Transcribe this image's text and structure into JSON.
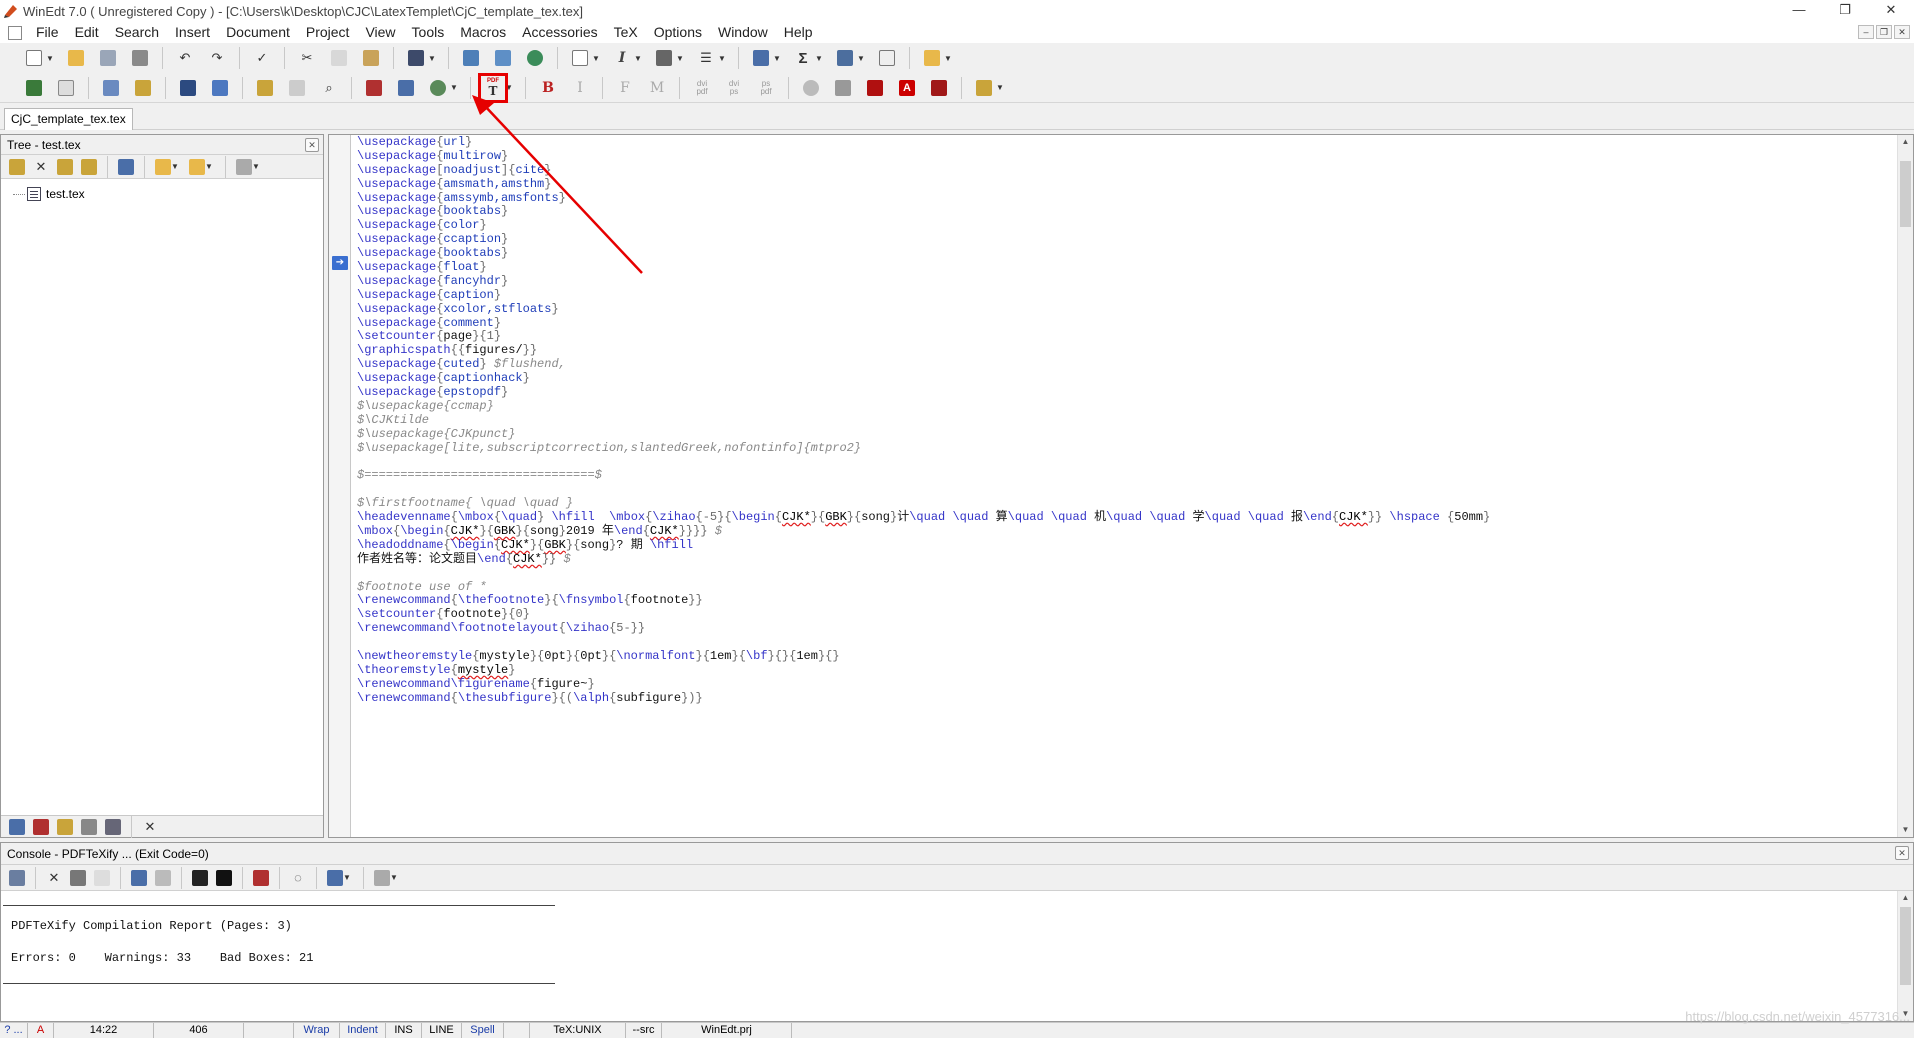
{
  "window": {
    "title": "WinEdt 7.0  ( Unregistered  Copy )  - [C:\\Users\\k\\Desktop\\CJC\\LatexTemplet\\CjC_template_tex.tex]",
    "controls": [
      "—",
      "❐",
      "✕"
    ]
  },
  "menu": [
    "File",
    "Edit",
    "Search",
    "Insert",
    "Document",
    "Project",
    "View",
    "Tools",
    "Macros",
    "Accessories",
    "TeX",
    "Options",
    "Window",
    "Help"
  ],
  "mdi_controls": [
    "–",
    "❐",
    "✕"
  ],
  "toolbar2_text": {
    "pdf_icon_label": "PDF",
    "bold": "B",
    "italic": "I",
    "f": "F",
    "m": "M",
    "dvi_pdf_top": "dvi",
    "dvi_pdf_bottom": "pdf",
    "dvi_ps_top": "dvi",
    "dvi_ps_bottom": "ps",
    "ps_pdf_top": "ps",
    "ps_pdf_bottom": "pdf"
  },
  "doc_tab": "CjC_template_tex.tex",
  "tree": {
    "title": "Tree - test.tex",
    "node": "test.tex"
  },
  "editor_lines": [
    [
      [
        "kw",
        "\\usepackage"
      ],
      [
        "br",
        "{"
      ],
      [
        "arg",
        "url"
      ],
      [
        "br",
        "}"
      ]
    ],
    [
      [
        "kw",
        "\\usepackage"
      ],
      [
        "br",
        "{"
      ],
      [
        "arg",
        "multirow"
      ],
      [
        "br",
        "}"
      ]
    ],
    [
      [
        "kw",
        "\\usepackage"
      ],
      [
        "br",
        "["
      ],
      [
        "arg",
        "noadjust"
      ],
      [
        "br",
        "]{"
      ],
      [
        "arg",
        "cite"
      ],
      [
        "br",
        "}"
      ]
    ],
    [
      [
        "kw",
        "\\usepackage"
      ],
      [
        "br",
        "{"
      ],
      [
        "arg",
        "amsmath,amsthm"
      ],
      [
        "br",
        "}"
      ]
    ],
    [
      [
        "kw",
        "\\usepackage"
      ],
      [
        "br",
        "{"
      ],
      [
        "arg",
        "amssymb,amsfonts"
      ],
      [
        "br",
        "}"
      ]
    ],
    [
      [
        "kw",
        "\\usepackage"
      ],
      [
        "br",
        "{"
      ],
      [
        "arg",
        "booktabs"
      ],
      [
        "br",
        "}"
      ]
    ],
    [
      [
        "kw",
        "\\usepackage"
      ],
      [
        "br",
        "{"
      ],
      [
        "arg",
        "color"
      ],
      [
        "br",
        "}"
      ]
    ],
    [
      [
        "kw",
        "\\usepackage"
      ],
      [
        "br",
        "{"
      ],
      [
        "arg",
        "ccaption"
      ],
      [
        "br",
        "}"
      ]
    ],
    [
      [
        "kw",
        "\\usepackage"
      ],
      [
        "br",
        "{"
      ],
      [
        "arg",
        "booktabs"
      ],
      [
        "br",
        "}"
      ]
    ],
    [
      [
        "kw",
        "\\usepackage"
      ],
      [
        "br",
        "{"
      ],
      [
        "arg",
        "float"
      ],
      [
        "br",
        "}"
      ]
    ],
    [
      [
        "kw",
        "\\usepackage"
      ],
      [
        "br",
        "{"
      ],
      [
        "arg",
        "fancyhdr"
      ],
      [
        "br",
        "}"
      ]
    ],
    [
      [
        "kw",
        "\\usepackage"
      ],
      [
        "br",
        "{"
      ],
      [
        "arg",
        "caption"
      ],
      [
        "br",
        "}"
      ]
    ],
    [
      [
        "kw",
        "\\usepackage"
      ],
      [
        "br",
        "{"
      ],
      [
        "arg",
        "xcolor,stfloats"
      ],
      [
        "br",
        "}"
      ]
    ],
    [
      [
        "kw",
        "\\usepackage"
      ],
      [
        "br",
        "{"
      ],
      [
        "arg",
        "comment"
      ],
      [
        "br",
        "}"
      ]
    ],
    [
      [
        "kw",
        "\\setcounter"
      ],
      [
        "br",
        "{"
      ],
      [
        "tx",
        "page"
      ],
      [
        "br",
        "}{"
      ],
      [
        "br",
        "1"
      ],
      [
        "br",
        "}"
      ]
    ],
    [
      [
        "kw",
        "\\graphicspath"
      ],
      [
        "br",
        "{{"
      ],
      [
        "tx",
        "figures/"
      ],
      [
        "br",
        "}}"
      ]
    ],
    [
      [
        "kw",
        "\\usepackage"
      ],
      [
        "br",
        "{"
      ],
      [
        "arg",
        "cuted"
      ],
      [
        "br",
        "}"
      ],
      [
        "cm",
        " $flushend,"
      ]
    ],
    [
      [
        "kw",
        "\\usepackage"
      ],
      [
        "br",
        "{"
      ],
      [
        "arg",
        "captionhack"
      ],
      [
        "br",
        "}"
      ]
    ],
    [
      [
        "kw",
        "\\usepackage"
      ],
      [
        "br",
        "{"
      ],
      [
        "arg",
        "epstopdf"
      ],
      [
        "br",
        "}"
      ]
    ],
    [
      [
        "cm",
        "$\\usepackage{ccmap}"
      ]
    ],
    [
      [
        "cm",
        "$\\CJKtilde"
      ]
    ],
    [
      [
        "cm",
        "$\\usepackage{CJKpunct}"
      ]
    ],
    [
      [
        "cm",
        "$\\usepackage[lite,subscriptcorrection,slantedGreek,nofontinfo]{mtpro2}"
      ]
    ],
    [],
    [
      [
        "cm",
        "$================================$"
      ]
    ],
    [],
    [
      [
        "cm",
        "$\\firstfootname{ \\quad \\quad }"
      ]
    ],
    [
      [
        "kw",
        "\\headevenname"
      ],
      [
        "br",
        "{"
      ],
      [
        "kw",
        "\\mbox"
      ],
      [
        "br",
        "{"
      ],
      [
        "kw",
        "\\quad"
      ],
      [
        "br",
        "} "
      ],
      [
        "kw",
        "\\hfill"
      ],
      [
        "tx",
        "  "
      ],
      [
        "kw",
        "\\mbox"
      ],
      [
        "br",
        "{"
      ],
      [
        "kw",
        "\\zihao"
      ],
      [
        "br",
        "{-5}{"
      ],
      [
        "kw",
        "\\begin"
      ],
      [
        "br",
        "{"
      ],
      [
        "sq",
        "CJK*"
      ],
      [
        "br",
        "}{"
      ],
      [
        "sq",
        "GBK"
      ],
      [
        "br",
        "}{"
      ],
      [
        "tx",
        "song"
      ],
      [
        "br",
        "}"
      ],
      [
        "tx",
        "计"
      ],
      [
        "kw",
        "\\quad"
      ],
      [
        "tx",
        " "
      ],
      [
        "kw",
        "\\quad"
      ],
      [
        "tx",
        " 算"
      ],
      [
        "kw",
        "\\quad"
      ],
      [
        "tx",
        " "
      ],
      [
        "kw",
        "\\quad"
      ],
      [
        "tx",
        " 机"
      ],
      [
        "kw",
        "\\quad"
      ],
      [
        "tx",
        " "
      ],
      [
        "kw",
        "\\quad"
      ],
      [
        "tx",
        " 学"
      ],
      [
        "kw",
        "\\quad"
      ],
      [
        "tx",
        " "
      ],
      [
        "kw",
        "\\quad"
      ],
      [
        "tx",
        " 报"
      ],
      [
        "kw",
        "\\end"
      ],
      [
        "br",
        "{"
      ],
      [
        "sq",
        "CJK*"
      ],
      [
        "br",
        "}} "
      ],
      [
        "kw",
        "\\hspace"
      ],
      [
        "br",
        " {"
      ],
      [
        "tx",
        "50mm"
      ],
      [
        "br",
        "}"
      ]
    ],
    [
      [
        "kw",
        "\\mbox"
      ],
      [
        "br",
        "{"
      ],
      [
        "kw",
        "\\begin"
      ],
      [
        "br",
        "{"
      ],
      [
        "sq",
        "CJK*"
      ],
      [
        "br",
        "}{"
      ],
      [
        "sq",
        "GBK"
      ],
      [
        "br",
        "}{"
      ],
      [
        "tx",
        "song"
      ],
      [
        "br",
        "}"
      ],
      [
        "tx",
        "2019 年"
      ],
      [
        "kw",
        "\\end"
      ],
      [
        "br",
        "{"
      ],
      [
        "sq",
        "CJK*"
      ],
      [
        "br",
        "}}}}"
      ],
      [
        "cm",
        " $"
      ]
    ],
    [
      [
        "kw",
        "\\headoddname"
      ],
      [
        "br",
        "{"
      ],
      [
        "kw",
        "\\begin"
      ],
      [
        "br",
        "{"
      ],
      [
        "sq",
        "CJK*"
      ],
      [
        "br",
        "}{"
      ],
      [
        "sq",
        "GBK"
      ],
      [
        "br",
        "}{"
      ],
      [
        "tx",
        "song"
      ],
      [
        "br",
        "}"
      ],
      [
        "tx",
        "? 期 "
      ],
      [
        "kw",
        "\\hfill"
      ]
    ],
    [
      [
        "tx",
        "作者姓名等：论文题目"
      ],
      [
        "kw",
        "\\end"
      ],
      [
        "br",
        "{"
      ],
      [
        "sq",
        "CJK*"
      ],
      [
        "br",
        "}}"
      ],
      [
        "cm",
        " $"
      ]
    ],
    [],
    [
      [
        "cm",
        "$footnote use of *"
      ]
    ],
    [
      [
        "kw",
        "\\renewcommand"
      ],
      [
        "br",
        "{"
      ],
      [
        "kw",
        "\\thefootnote"
      ],
      [
        "br",
        "}{"
      ],
      [
        "kw",
        "\\fnsymbol"
      ],
      [
        "br",
        "{"
      ],
      [
        "tx",
        "footnote"
      ],
      [
        "br",
        "}}"
      ]
    ],
    [
      [
        "kw",
        "\\setcounter"
      ],
      [
        "br",
        "{"
      ],
      [
        "tx",
        "footnote"
      ],
      [
        "br",
        "}{"
      ],
      [
        "br",
        "0"
      ],
      [
        "br",
        "}"
      ]
    ],
    [
      [
        "kw",
        "\\renewcommand"
      ],
      [
        "kw",
        "\\footnotelayout"
      ],
      [
        "br",
        "{"
      ],
      [
        "kw",
        "\\zihao"
      ],
      [
        "br",
        "{5-}}"
      ]
    ],
    [],
    [
      [
        "kw",
        "\\newtheoremstyle"
      ],
      [
        "br",
        "{"
      ],
      [
        "tx",
        "mystyle"
      ],
      [
        "br",
        "}{"
      ],
      [
        "tx",
        "0pt"
      ],
      [
        "br",
        "}{"
      ],
      [
        "tx",
        "0pt"
      ],
      [
        "br",
        "}{"
      ],
      [
        "kw",
        "\\normalfont"
      ],
      [
        "br",
        "}{"
      ],
      [
        "tx",
        "1em"
      ],
      [
        "br",
        "}{"
      ],
      [
        "kw",
        "\\bf"
      ],
      [
        "br",
        "}{}{"
      ],
      [
        "tx",
        "1em"
      ],
      [
        "br",
        "}{}"
      ]
    ],
    [
      [
        "kw",
        "\\theoremstyle"
      ],
      [
        "br",
        "{"
      ],
      [
        "sq",
        "mystyle"
      ],
      [
        "br",
        "}"
      ]
    ],
    [
      [
        "kw",
        "\\renewcommand"
      ],
      [
        "kw",
        "\\figurename"
      ],
      [
        "br",
        "{"
      ],
      [
        "tx",
        "figure~"
      ],
      [
        "br",
        "}"
      ]
    ],
    [
      [
        "kw",
        "\\renewcommand"
      ],
      [
        "br",
        "{"
      ],
      [
        "kw",
        "\\thesubfigure"
      ],
      [
        "br",
        "}{("
      ],
      [
        "kw",
        "\\alph"
      ],
      [
        "br",
        "{"
      ],
      [
        "tx",
        "subfigure"
      ],
      [
        "br",
        "})}"
      ]
    ]
  ],
  "console": {
    "title": "Console - PDFTeXify ... (Exit Code=0)",
    "report": "PDFTeXify Compilation Report (Pages: 3)",
    "summary": "Errors: 0    Warnings: 33    Bad Boxes: 21"
  },
  "status": {
    "help": "? ...",
    "flag": "A",
    "position": "14:22",
    "lines": "406",
    "wrap": "Wrap",
    "indent": "Indent",
    "ins": "INS",
    "line_mode": "LINE",
    "spell": "Spell",
    "mode": "TeX:UNIX",
    "src": "--src",
    "project": "WinEdt.prj"
  },
  "watermark": "https://blog.csdn.net/weixin_4577316..."
}
